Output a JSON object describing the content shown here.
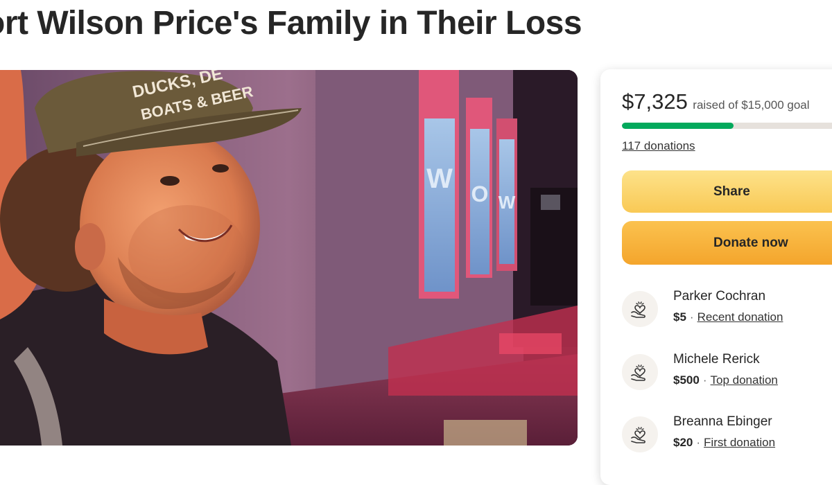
{
  "page": {
    "title": "ort Wilson Price's Family in Their Loss"
  },
  "photo": {
    "alt": "campaign-photo",
    "cap_text_line1": "DUCKS, DE",
    "cap_text_line2": "BOATS & BEER",
    "sign_letters": [
      "W",
      "O",
      "W"
    ]
  },
  "fundraiser": {
    "raised_amount": "$7,325",
    "raised_text": "raised of $15,000 goal",
    "progress_fraction": 0.488,
    "progress_color": "#02a95c",
    "donation_count": "117 donations",
    "share_label": "Share",
    "donate_label": "Donate now"
  },
  "donors": [
    {
      "name": "Parker Cochran",
      "amount": "$5",
      "separator": "·",
      "tag": "Recent donation",
      "icon": "heart-hand-icon"
    },
    {
      "name": "Michele Rerick",
      "amount": "$500",
      "separator": "·",
      "tag": "Top donation",
      "icon": "heart-hand-icon"
    },
    {
      "name": "Breanna Ebinger",
      "amount": "$20",
      "separator": "·",
      "tag": "First donation",
      "icon": "heart-hand-icon"
    }
  ]
}
